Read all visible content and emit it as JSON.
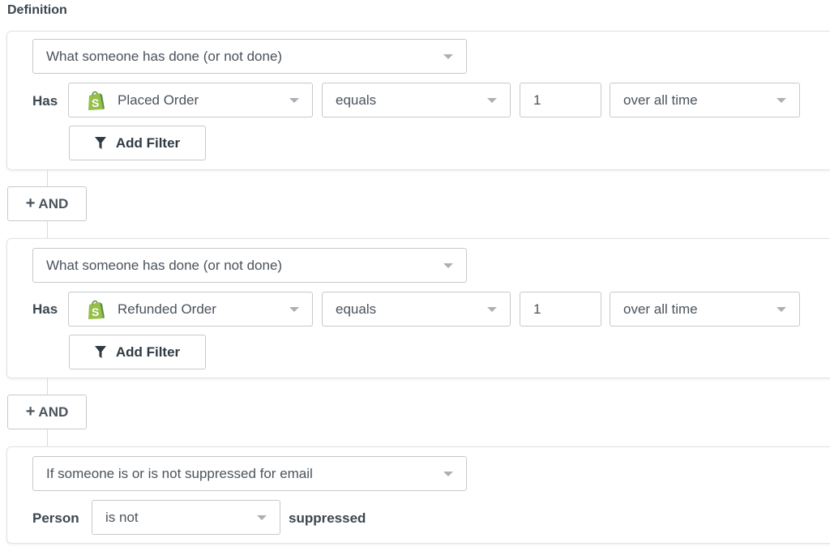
{
  "title": "Definition",
  "conditions": [
    {
      "type": "What someone has done (or not done)",
      "has_label": "Has",
      "event": "Placed Order",
      "event_icon": "shopify-icon",
      "operator": "equals",
      "value": "1",
      "timeframe": "over all time",
      "filter_label": "Add Filter"
    },
    {
      "type": "What someone has done (or not done)",
      "has_label": "Has",
      "event": "Refunded Order",
      "event_icon": "shopify-icon",
      "operator": "equals",
      "value": "1",
      "timeframe": "over all time",
      "filter_label": "Add Filter"
    }
  ],
  "and_label": "AND",
  "suppression": {
    "type": "If someone is or is not suppressed for email",
    "person_label": "Person",
    "operator": "is not",
    "suffix": "suppressed"
  },
  "colors": {
    "shopify": "#95bf47",
    "border": "#c5c9ce"
  }
}
